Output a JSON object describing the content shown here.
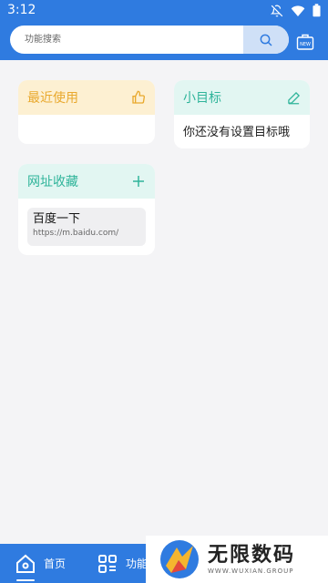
{
  "status": {
    "time": "3:12",
    "icons": [
      "bell-off-icon",
      "wifi-icon",
      "battery-icon"
    ]
  },
  "search": {
    "placeholder": "功能搜索"
  },
  "cards": {
    "recent": {
      "title": "最近使用",
      "icon": "thumbs-up-icon"
    },
    "goal": {
      "title": "小目标",
      "icon": "edit-icon",
      "empty_text": "你还没有设置目标哦"
    },
    "bookmarks": {
      "title": "网址收藏",
      "icon": "plus-icon",
      "items": [
        {
          "name": "百度一下",
          "url": "https://m.baidu.com/"
        }
      ]
    }
  },
  "nav": {
    "home_label": "首页",
    "func_label": "功能"
  },
  "watermark": {
    "cn": "无限数码",
    "en": "WWW.WUXIAN.GROUP"
  },
  "colors": {
    "primary": "#2f7be0",
    "recent_accent": "#e9a92e",
    "teal_accent": "#2fb49a"
  }
}
